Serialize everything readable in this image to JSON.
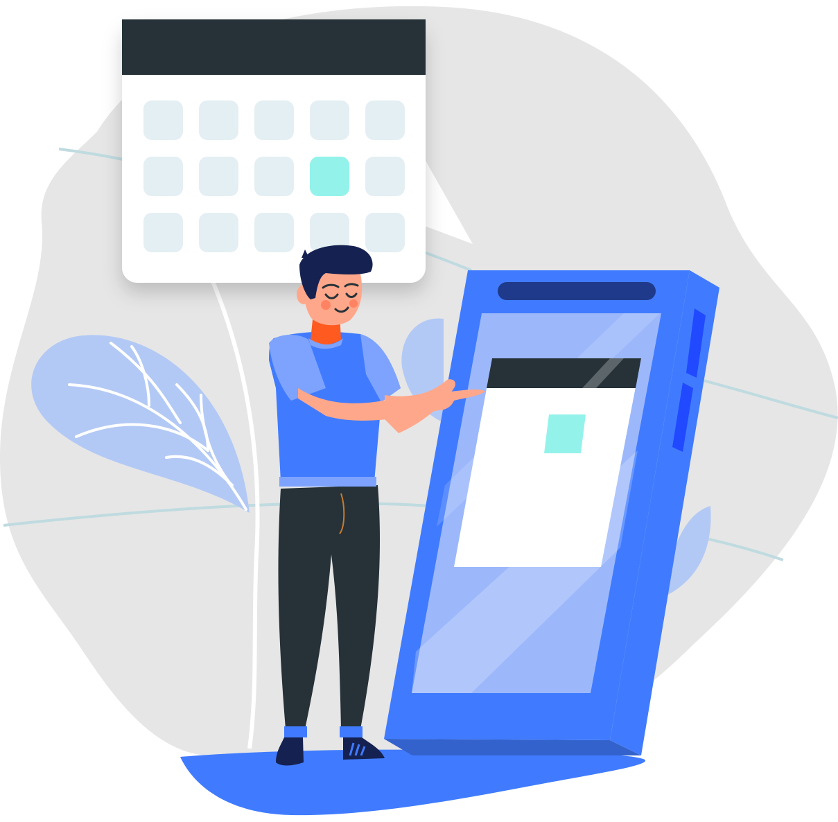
{
  "illustration": {
    "subject": "calendar-scheduling-scene",
    "calendar": {
      "columns": 5,
      "rows": 3,
      "highlighted_cell": {
        "row": 2,
        "column": 4
      }
    },
    "colors": {
      "background_blob": "#e6e6e6",
      "guide_lines": "#bfdbe0",
      "accent_blue": "#407bff",
      "light_blue": "#9cb8fb",
      "pale_blue": "#b3c9f5",
      "dark_navy": "#263238",
      "highlight_mint": "#93f3ea",
      "cell_fill": "#e4eff3",
      "skin": "#ffa78a",
      "hair": "#152151"
    }
  }
}
